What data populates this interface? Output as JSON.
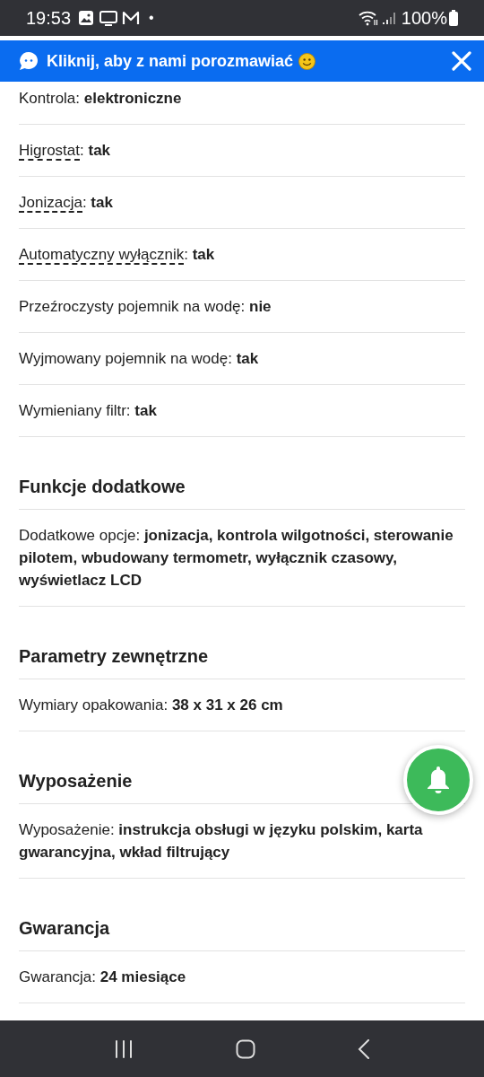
{
  "status_bar": {
    "time": "19:53",
    "dot": "•",
    "battery": "100%"
  },
  "chat_banner": {
    "text": "Kliknij, aby z nami porozmawiać"
  },
  "sections": [
    {
      "rows": [
        {
          "label": "Kontrola:",
          "value": "elektroniczne",
          "dashed": false
        },
        {
          "label": "Higrostat:",
          "value": "tak",
          "dashed": true
        },
        {
          "label": "Jonizacja:",
          "value": "tak",
          "dashed": true
        },
        {
          "label": "Automatyczny wyłącznik:",
          "value": "tak",
          "dashed": true
        },
        {
          "label": "Przeźroczysty pojemnik na wodę:",
          "value": "nie",
          "dashed": false
        },
        {
          "label": "Wyjmowany pojemnik na wodę:",
          "value": "tak",
          "dashed": false
        },
        {
          "label": "Wymieniany filtr:",
          "value": "tak",
          "dashed": false
        }
      ]
    },
    {
      "title": "Funkcje dodatkowe",
      "rows": [
        {
          "label": "Dodatkowe opcje:",
          "value": "jonizacja, kontrola wilgotności, sterowanie pilotem, wbudowany termometr, wyłącznik czasowy, wyświetlacz LCD",
          "dashed": false
        }
      ]
    },
    {
      "title": "Parametry zewnętrzne",
      "rows": [
        {
          "label": "Wymiary opakowania:",
          "value": "38 x 31 x 26 cm",
          "dashed": false
        }
      ]
    },
    {
      "title": "Wyposażenie",
      "rows": [
        {
          "label": "Wyposażenie:",
          "value": "instrukcja obsługi w języku polskim, karta gwarancyjna, wkład filtrujący",
          "dashed": false
        }
      ]
    },
    {
      "title": "Gwarancja",
      "rows": [
        {
          "label": "Gwarancja:",
          "value": "24 miesiące",
          "dashed": false
        }
      ]
    }
  ]
}
